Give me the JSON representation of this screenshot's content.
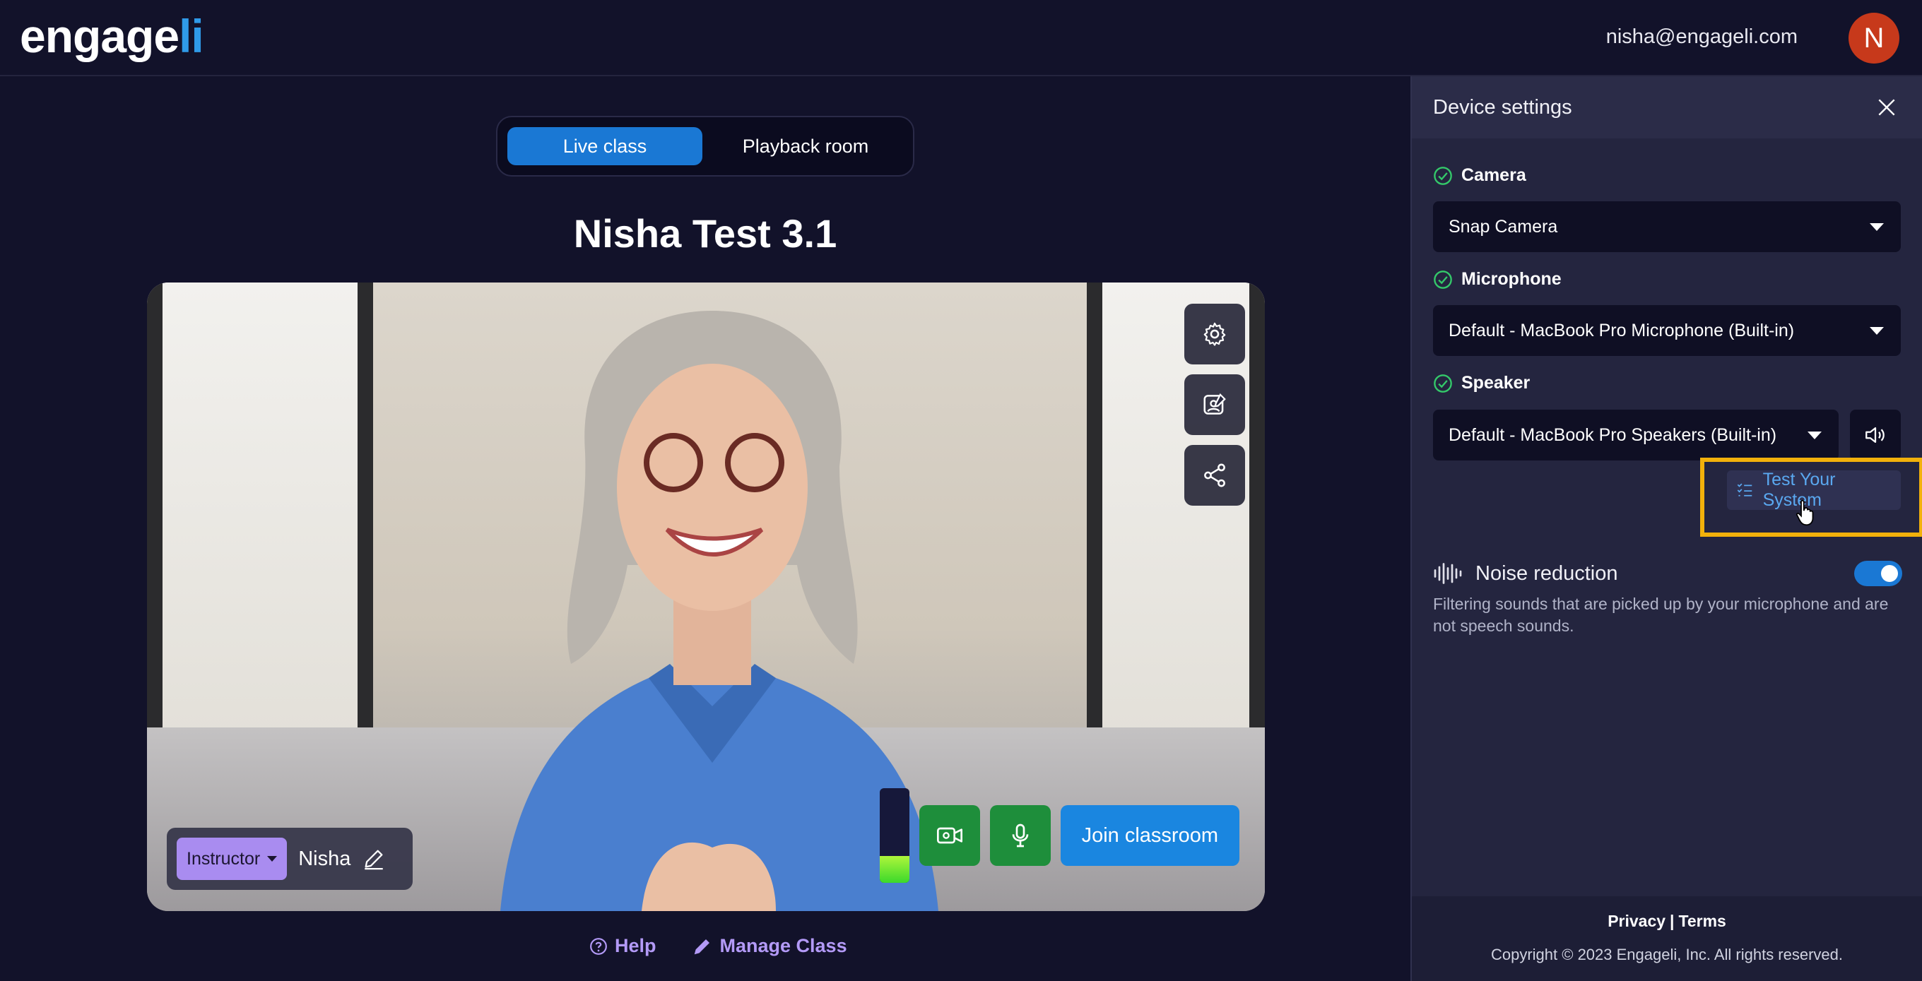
{
  "header": {
    "logo_main": "engage",
    "logo_accent": "li",
    "user_email": "nisha@engageli.com",
    "avatar_initial": "N"
  },
  "mode_toggle": {
    "live": "Live class",
    "playback": "Playback room",
    "selected": "Live class"
  },
  "class_title": "Nisha Test 3.1",
  "video": {
    "role": "Instructor",
    "participant_name": "Nisha",
    "mic_level_percent": 28,
    "join_label": "Join classroom",
    "tool_icons": [
      "settings-icon",
      "edit-background-icon",
      "share-icon"
    ]
  },
  "footer": {
    "help": "Help",
    "manage": "Manage Class"
  },
  "device_settings": {
    "title": "Device settings",
    "camera": {
      "label": "Camera",
      "value": "Snap Camera"
    },
    "microphone": {
      "label": "Microphone",
      "value": "Default - MacBook Pro Microphone (Built-in)"
    },
    "speaker": {
      "label": "Speaker",
      "value": "Default - MacBook Pro Speakers (Built-in)"
    },
    "test_system": "Test Your System",
    "noise_reduction": {
      "label": "Noise reduction",
      "enabled": true,
      "description": "Filtering sounds that are picked up by your microphone and are not speech sounds."
    },
    "privacy": "Privacy",
    "terms": "Terms",
    "separator": "|",
    "copyright": "Copyright © 2023 Engageli, Inc. All rights reserved."
  },
  "colors": {
    "accent_blue": "#1a78d4",
    "success_green": "#1e8e3b",
    "highlight_yellow": "#f2b10b",
    "instructor_purple": "#a98cf0",
    "avatar_red": "#c7391b"
  }
}
